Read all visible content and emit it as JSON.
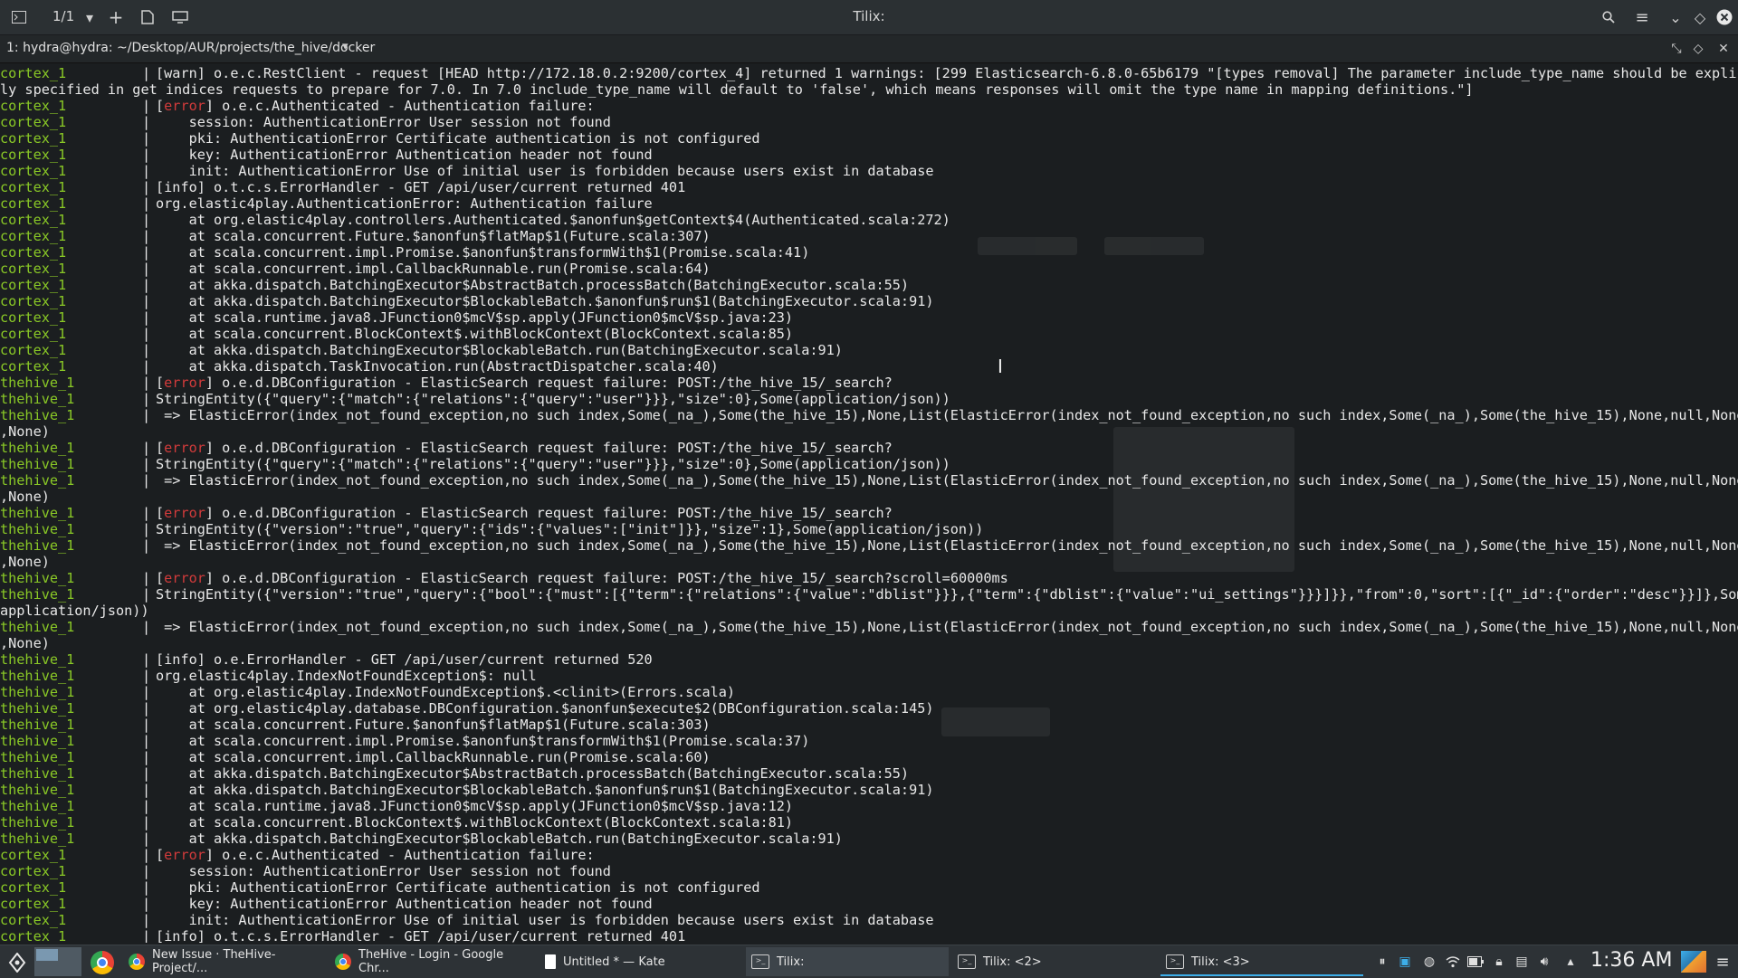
{
  "titlebar": {
    "title": "Tilix:",
    "session_counter": "1/1"
  },
  "pathbar": {
    "title": "1: hydra@hydra: ~/Desktop/AUR/projects/the_hive/docker"
  },
  "terminal": {
    "lines": [
      {
        "svc": "cortex_1",
        "pipe": "|",
        "level": "warn",
        "text": " o.e.c.RestClient - request [HEAD http://172.18.0.2:9200/cortex_4] returned 1 warnings: [299 Elasticsearch-6.8.0-65b6179 \"[types removal] The parameter include_type_name should be explicit"
      },
      {
        "cont": "ly specified in get indices requests to prepare for 7.0. In 7.0 include_type_name will default to 'false', which means responses will omit the type name in mapping definitions.\"]"
      },
      {
        "svc": "cortex_1",
        "pipe": "|",
        "level": "error",
        "text": " o.e.c.Authenticated - Authentication failure:"
      },
      {
        "svc": "cortex_1",
        "pipe": "|",
        "text": "    session: AuthenticationError User session not found"
      },
      {
        "svc": "cortex_1",
        "pipe": "|",
        "text": "    pki: AuthenticationError Certificate authentication is not configured"
      },
      {
        "svc": "cortex_1",
        "pipe": "|",
        "text": "    key: AuthenticationError Authentication header not found"
      },
      {
        "svc": "cortex_1",
        "pipe": "|",
        "text": "    init: AuthenticationError Use of initial user is forbidden because users exist in database"
      },
      {
        "svc": "cortex_1",
        "pipe": "|",
        "level": "info",
        "text": " o.t.c.s.ErrorHandler - GET /api/user/current returned 401"
      },
      {
        "svc": "cortex_1",
        "pipe": "|",
        "text": "org.elastic4play.AuthenticationError: Authentication failure"
      },
      {
        "svc": "cortex_1",
        "pipe": "|",
        "text": "    at org.elastic4play.controllers.Authenticated.$anonfun$getContext$4(Authenticated.scala:272)"
      },
      {
        "svc": "cortex_1",
        "pipe": "|",
        "text": "    at scala.concurrent.Future.$anonfun$flatMap$1(Future.scala:307)"
      },
      {
        "svc": "cortex_1",
        "pipe": "|",
        "text": "    at scala.concurrent.impl.Promise.$anonfun$transformWith$1(Promise.scala:41)"
      },
      {
        "svc": "cortex_1",
        "pipe": "|",
        "text": "    at scala.concurrent.impl.CallbackRunnable.run(Promise.scala:64)"
      },
      {
        "svc": "cortex_1",
        "pipe": "|",
        "text": "    at akka.dispatch.BatchingExecutor$AbstractBatch.processBatch(BatchingExecutor.scala:55)"
      },
      {
        "svc": "cortex_1",
        "pipe": "|",
        "text": "    at akka.dispatch.BatchingExecutor$BlockableBatch.$anonfun$run$1(BatchingExecutor.scala:91)"
      },
      {
        "svc": "cortex_1",
        "pipe": "|",
        "text": "    at scala.runtime.java8.JFunction0$mcV$sp.apply(JFunction0$mcV$sp.java:23)"
      },
      {
        "svc": "cortex_1",
        "pipe": "|",
        "text": "    at scala.concurrent.BlockContext$.withBlockContext(BlockContext.scala:85)"
      },
      {
        "svc": "cortex_1",
        "pipe": "|",
        "text": "    at akka.dispatch.BatchingExecutor$BlockableBatch.run(BatchingExecutor.scala:91)"
      },
      {
        "svc": "cortex_1",
        "pipe": "|",
        "text": "    at akka.dispatch.TaskInvocation.run(AbstractDispatcher.scala:40)"
      },
      {
        "svc": "thehive_1",
        "pipe": "|",
        "level": "error",
        "text": " o.e.d.DBConfiguration - ElasticSearch request failure: POST:/the_hive_15/_search?"
      },
      {
        "svc": "thehive_1",
        "pipe": "|",
        "text": "StringEntity({\"query\":{\"match\":{\"relations\":{\"query\":\"user\"}}},\"size\":0},Some(application/json))"
      },
      {
        "svc": "thehive_1",
        "pipe": "|",
        "text": " => ElasticError(index_not_found_exception,no such index,Some(_na_),Some(the_hive_15),None,List(ElasticError(index_not_found_exception,no such index,Some(_na_),Some(the_hive_15),None,null,None))"
      },
      {
        "cont": ",None)"
      },
      {
        "svc": "thehive_1",
        "pipe": "|",
        "level": "error",
        "text": " o.e.d.DBConfiguration - ElasticSearch request failure: POST:/the_hive_15/_search?"
      },
      {
        "svc": "thehive_1",
        "pipe": "|",
        "text": "StringEntity({\"query\":{\"match\":{\"relations\":{\"query\":\"user\"}}},\"size\":0},Some(application/json))"
      },
      {
        "svc": "thehive_1",
        "pipe": "|",
        "text": " => ElasticError(index_not_found_exception,no such index,Some(_na_),Some(the_hive_15),None,List(ElasticError(index_not_found_exception,no such index,Some(_na_),Some(the_hive_15),None,null,None))"
      },
      {
        "cont": ",None)"
      },
      {
        "svc": "thehive_1",
        "pipe": "|",
        "level": "error",
        "text": " o.e.d.DBConfiguration - ElasticSearch request failure: POST:/the_hive_15/_search?"
      },
      {
        "svc": "thehive_1",
        "pipe": "|",
        "text": "StringEntity({\"version\":\"true\",\"query\":{\"ids\":{\"values\":[\"init\"]}},\"size\":1},Some(application/json))"
      },
      {
        "svc": "thehive_1",
        "pipe": "|",
        "text": " => ElasticError(index_not_found_exception,no such index,Some(_na_),Some(the_hive_15),None,List(ElasticError(index_not_found_exception,no such index,Some(_na_),Some(the_hive_15),None,null,None))"
      },
      {
        "cont": ",None)"
      },
      {
        "svc": "thehive_1",
        "pipe": "|",
        "level": "error",
        "text": " o.e.d.DBConfiguration - ElasticSearch request failure: POST:/the_hive_15/_search?scroll=60000ms"
      },
      {
        "svc": "thehive_1",
        "pipe": "|",
        "text": "StringEntity({\"version\":\"true\",\"query\":{\"bool\":{\"must\":[{\"term\":{\"relations\":{\"value\":\"dblist\"}}},{\"term\":{\"dblist\":{\"value\":\"ui_settings\"}}}]}},\"from\":0,\"sort\":[{\"_id\":{\"order\":\"desc\"}}]},Some("
      },
      {
        "cont": "application/json))"
      },
      {
        "svc": "thehive_1",
        "pipe": "|",
        "text": " => ElasticError(index_not_found_exception,no such index,Some(_na_),Some(the_hive_15),None,List(ElasticError(index_not_found_exception,no such index,Some(_na_),Some(the_hive_15),None,null,None))"
      },
      {
        "cont": ",None)"
      },
      {
        "svc": "thehive_1",
        "pipe": "|",
        "level": "info",
        "text": " o.e.ErrorHandler - GET /api/user/current returned 520"
      },
      {
        "svc": "thehive_1",
        "pipe": "|",
        "text": "org.elastic4play.IndexNotFoundException$: null"
      },
      {
        "svc": "thehive_1",
        "pipe": "|",
        "text": "    at org.elastic4play.IndexNotFoundException$.<clinit>(Errors.scala)"
      },
      {
        "svc": "thehive_1",
        "pipe": "|",
        "text": "    at org.elastic4play.database.DBConfiguration.$anonfun$execute$2(DBConfiguration.scala:145)"
      },
      {
        "svc": "thehive_1",
        "pipe": "|",
        "text": "    at scala.concurrent.Future.$anonfun$flatMap$1(Future.scala:303)"
      },
      {
        "svc": "thehive_1",
        "pipe": "|",
        "text": "    at scala.concurrent.impl.Promise.$anonfun$transformWith$1(Promise.scala:37)"
      },
      {
        "svc": "thehive_1",
        "pipe": "|",
        "text": "    at scala.concurrent.impl.CallbackRunnable.run(Promise.scala:60)"
      },
      {
        "svc": "thehive_1",
        "pipe": "|",
        "text": "    at akka.dispatch.BatchingExecutor$AbstractBatch.processBatch(BatchingExecutor.scala:55)"
      },
      {
        "svc": "thehive_1",
        "pipe": "|",
        "text": "    at akka.dispatch.BatchingExecutor$BlockableBatch.$anonfun$run$1(BatchingExecutor.scala:91)"
      },
      {
        "svc": "thehive_1",
        "pipe": "|",
        "text": "    at scala.runtime.java8.JFunction0$mcV$sp.apply(JFunction0$mcV$sp.java:12)"
      },
      {
        "svc": "thehive_1",
        "pipe": "|",
        "text": "    at scala.concurrent.BlockContext$.withBlockContext(BlockContext.scala:81)"
      },
      {
        "svc": "thehive_1",
        "pipe": "|",
        "text": "    at akka.dispatch.BatchingExecutor$BlockableBatch.run(BatchingExecutor.scala:91)"
      },
      {
        "svc": "cortex_1",
        "pipe": "|",
        "level": "error",
        "text": " o.e.c.Authenticated - Authentication failure:"
      },
      {
        "svc": "cortex_1",
        "pipe": "|",
        "text": "    session: AuthenticationError User session not found"
      },
      {
        "svc": "cortex_1",
        "pipe": "|",
        "text": "    pki: AuthenticationError Certificate authentication is not configured"
      },
      {
        "svc": "cortex_1",
        "pipe": "|",
        "text": "    key: AuthenticationError Authentication header not found"
      },
      {
        "svc": "cortex_1",
        "pipe": "|",
        "text": "    init: AuthenticationError Use of initial user is forbidden because users exist in database"
      },
      {
        "svc": "cortex_1",
        "pipe": "|",
        "level": "info",
        "text": " o.t.c.s.ErrorHandler - GET /api/user/current returned 401"
      }
    ]
  },
  "taskbar": {
    "tasks": [
      {
        "label": "New Issue · TheHive-Project/...",
        "icon": "chrome-icon",
        "active": false
      },
      {
        "label": "TheHive - Login - Google Chr...",
        "icon": "chrome-icon",
        "active": false
      },
      {
        "label": "Untitled * — Kate",
        "icon": "kate-icon",
        "active": false
      },
      {
        "label": "Tilix:",
        "icon": "tilix-icon",
        "active": true
      },
      {
        "label": "Tilix: <2>",
        "icon": "tilix-icon",
        "active": false
      },
      {
        "label": "Tilix: <3>",
        "icon": "tilix-icon",
        "active": false
      }
    ],
    "clock": "1:36 AM"
  },
  "colors": {
    "service_name": "#8ac926",
    "error_level": "#d23b3b",
    "terminal_bg": "#1b1e20",
    "accent": "#3daee9"
  }
}
